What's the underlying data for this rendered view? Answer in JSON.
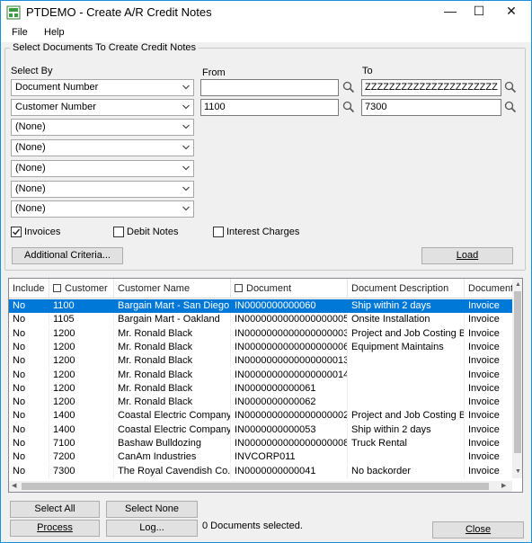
{
  "window": {
    "title": "PTDEMO - Create A/R Credit Notes",
    "minimize_glyph": "—",
    "maximize_glyph": "☐",
    "close_glyph": "✕"
  },
  "menu": {
    "file": "File",
    "help": "Help"
  },
  "criteria": {
    "group_title": "Select Documents To Create Credit Notes",
    "select_by_label": "Select By",
    "from_label": "From",
    "to_label": "To",
    "rows": [
      {
        "field": "Document Number",
        "from": "",
        "to": "ZZZZZZZZZZZZZZZZZZZZZZ"
      },
      {
        "field": "Customer Number",
        "from": "1100",
        "to": "7300"
      },
      {
        "field": "(None)"
      },
      {
        "field": "(None)"
      },
      {
        "field": "(None)"
      },
      {
        "field": "(None)"
      },
      {
        "field": "(None)"
      }
    ],
    "invoices": {
      "label": "Invoices",
      "checked": true
    },
    "debit_notes": {
      "label": "Debit Notes",
      "checked": false
    },
    "interest_charges": {
      "label": "Interest Charges",
      "checked": false
    },
    "additional_criteria": "Additional Criteria...",
    "load": "Load"
  },
  "grid": {
    "columns": [
      "Include",
      "Customer",
      "Customer Name",
      "Document",
      "Document Description",
      "Document Type"
    ],
    "rows": [
      [
        "No",
        "1100",
        "Bargain Mart - San Diego",
        "IN0000000000060",
        "Ship within 2 days",
        "Invoice"
      ],
      [
        "No",
        "1105",
        "Bargain Mart - Oakland",
        "IN0000000000000000005",
        "Onsite Installation",
        "Invoice"
      ],
      [
        "No",
        "1200",
        "Mr. Ronald Black",
        "IN0000000000000000003",
        "Project and Job Costing B...",
        "Invoice"
      ],
      [
        "No",
        "1200",
        "Mr. Ronald Black",
        "IN0000000000000000006",
        "Equipment Maintains",
        "Invoice"
      ],
      [
        "No",
        "1200",
        "Mr. Ronald Black",
        "IN0000000000000000013",
        "",
        "Invoice"
      ],
      [
        "No",
        "1200",
        "Mr. Ronald Black",
        "IN0000000000000000014",
        "",
        "Invoice"
      ],
      [
        "No",
        "1200",
        "Mr. Ronald Black",
        "IN0000000000061",
        "",
        "Invoice"
      ],
      [
        "No",
        "1200",
        "Mr. Ronald Black",
        "IN0000000000062",
        "",
        "Invoice"
      ],
      [
        "No",
        "1400",
        "Coastal Electric Company",
        "IN0000000000000000002",
        "Project and Job Costing B...",
        "Invoice"
      ],
      [
        "No",
        "1400",
        "Coastal Electric Company",
        "IN0000000000053",
        "Ship within 2 days",
        "Invoice"
      ],
      [
        "No",
        "7100",
        "Bashaw Bulldozing",
        "IN0000000000000000008",
        "Truck Rental",
        "Invoice"
      ],
      [
        "No",
        "7200",
        "CanAm Industries",
        "INVCORP011",
        "",
        "Invoice"
      ],
      [
        "No",
        "7300",
        "The Royal Cavendish Co.",
        "IN0000000000041",
        "No backorder",
        "Invoice"
      ]
    ],
    "selected_row": 0
  },
  "buttons": {
    "select_all": "Select All",
    "select_none": "Select None",
    "process": "Process",
    "log": "Log...",
    "close": "Close"
  },
  "status": "0 Documents selected.",
  "colors": {
    "selection": "#0078d7",
    "window_border": "#1a8fd6"
  }
}
